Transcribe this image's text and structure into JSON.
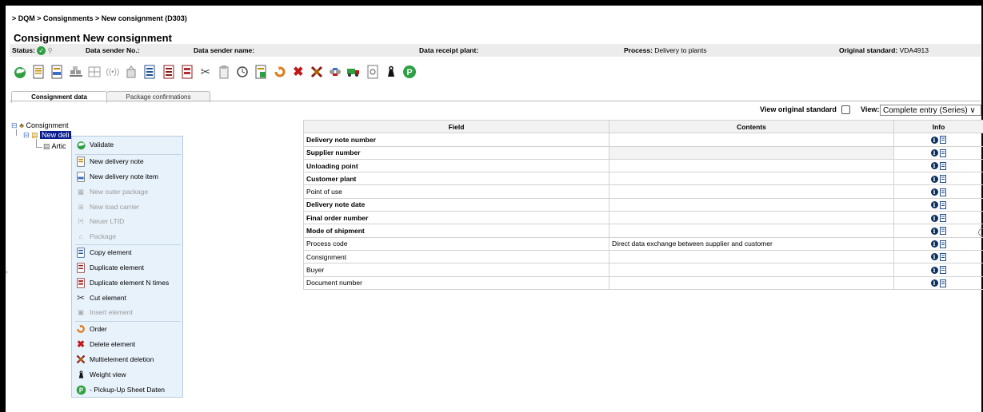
{
  "breadcrumb": "> DQM > Consignments > New consignment (D303)",
  "title": "Consignment New consignment",
  "status_bar": {
    "status_label": "Status:",
    "sender_no_label": "Data sender No.:",
    "sender_name_label": "Data sender name:",
    "receipt_plant_label": "Data receipt plant:",
    "process_label": "Process:",
    "process_value": "Delivery to plants",
    "original_standard_label": "Original standard:",
    "original_standard_value": "VDA4913"
  },
  "toolbar_icons": [
    "validate-icon",
    "new-delivery-note-icon",
    "new-delivery-note-item-icon",
    "new-outer-package-icon",
    "new-load-carrier-icon",
    "ltid-icon",
    "package-icon",
    "copy-element-icon",
    "duplicate-element-icon",
    "duplicate-n-times-icon",
    "cut-icon",
    "insert-icon",
    "history-icon",
    "export-icon",
    "order-icon",
    "delete-icon",
    "multidelete-icon",
    "transfer-icon",
    "truck-icon",
    "preview-icon",
    "weight-icon",
    "pickup-icon"
  ],
  "tabs": [
    {
      "label": "Consignment data",
      "active": true
    },
    {
      "label": "Package confirmations",
      "active": false
    }
  ],
  "view_original_label": "View original standard",
  "view_label": "View:",
  "view_select": "Complete entry (Series) ∨",
  "tree": {
    "root": "Consignment",
    "child": "New deli",
    "grandchild": "Artic"
  },
  "context_menu": [
    {
      "label": "Validate",
      "icon": "validate-icon",
      "enabled": true
    },
    {
      "label": "New delivery note",
      "icon": "new-delivery-note-icon",
      "enabled": true
    },
    {
      "label": "New delivery note item",
      "icon": "new-delivery-note-item-icon",
      "enabled": true
    },
    {
      "label": "New outer package",
      "icon": "new-outer-package-icon",
      "enabled": false
    },
    {
      "label": "New load carrier",
      "icon": "new-load-carrier-icon",
      "enabled": false
    },
    {
      "label": "Neuer LTID",
      "icon": "ltid-icon",
      "enabled": false
    },
    {
      "label": "Package",
      "icon": "package-icon",
      "enabled": false
    },
    {
      "label": "Copy element",
      "icon": "copy-icon",
      "enabled": true
    },
    {
      "label": "Duplicate element",
      "icon": "duplicate-icon",
      "enabled": true
    },
    {
      "label": "Duplicate element N times",
      "icon": "duplicate-n-icon",
      "enabled": true
    },
    {
      "label": "Cut element",
      "icon": "cut-icon",
      "enabled": true
    },
    {
      "label": "Insert element",
      "icon": "insert-icon",
      "enabled": false
    },
    {
      "label": "Order",
      "icon": "order-icon",
      "enabled": true
    },
    {
      "label": "Delete element",
      "icon": "delete-icon",
      "enabled": true
    },
    {
      "label": "Multielement deletion",
      "icon": "multidelete-icon",
      "enabled": true
    },
    {
      "label": "Weight view",
      "icon": "weight-icon",
      "enabled": true
    },
    {
      "label": "- Pickup-Up Sheet Daten",
      "icon": "pickup-icon",
      "enabled": true
    }
  ],
  "table": {
    "headers": [
      "Field",
      "Contents",
      "Info"
    ],
    "rows": [
      {
        "field": "Delivery note number",
        "contents": "",
        "bold": true
      },
      {
        "field": "Supplier number",
        "contents": "",
        "bold": true
      },
      {
        "field": "Unloading point",
        "contents": "",
        "bold": true
      },
      {
        "field": "Customer plant",
        "contents": "",
        "bold": true
      },
      {
        "field": "Point of use",
        "contents": "",
        "bold": false
      },
      {
        "field": "Delivery note date",
        "contents": "",
        "bold": true
      },
      {
        "field": "Final order number",
        "contents": "",
        "bold": true
      },
      {
        "field": "Mode of shipment",
        "contents": "",
        "bold": true
      },
      {
        "field": "Process code",
        "contents": "Direct data exchange between supplier and customer",
        "bold": false
      },
      {
        "field": "Consignment",
        "contents": "",
        "bold": false
      },
      {
        "field": "Buyer",
        "contents": "",
        "bold": false
      },
      {
        "field": "Document number",
        "contents": "",
        "bold": false
      }
    ]
  },
  "colors": {
    "accent_green": "#2ea043",
    "delete_red": "#c0181a",
    "selection": "#0a1f8f",
    "menu_bg": "#e8f2fb"
  }
}
